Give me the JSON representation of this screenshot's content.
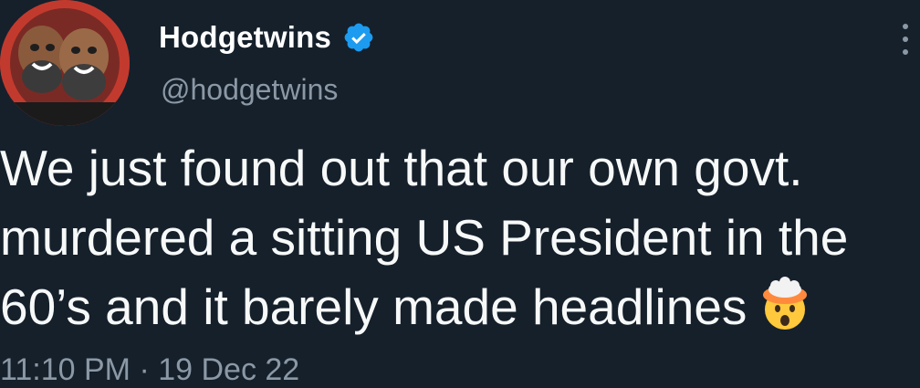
{
  "author": {
    "display_name": "Hodgetwins",
    "handle": "@hodgetwins",
    "verified_icon": "verified-badge-icon",
    "avatar_icon": "profile-photo"
  },
  "tweet": {
    "lines": [
      "We just found out that our own govt.",
      "murdered a sitting US President in the",
      "60’s and it barely made headlines"
    ],
    "emoji": "exploding-head-emoji"
  },
  "meta": {
    "timestamp": "11:10 PM · 19 Dec 22"
  },
  "colors": {
    "background": "#15202b",
    "text": "#f7f9f9",
    "secondary": "#8b98a5",
    "verified": "#1d9bf0"
  }
}
